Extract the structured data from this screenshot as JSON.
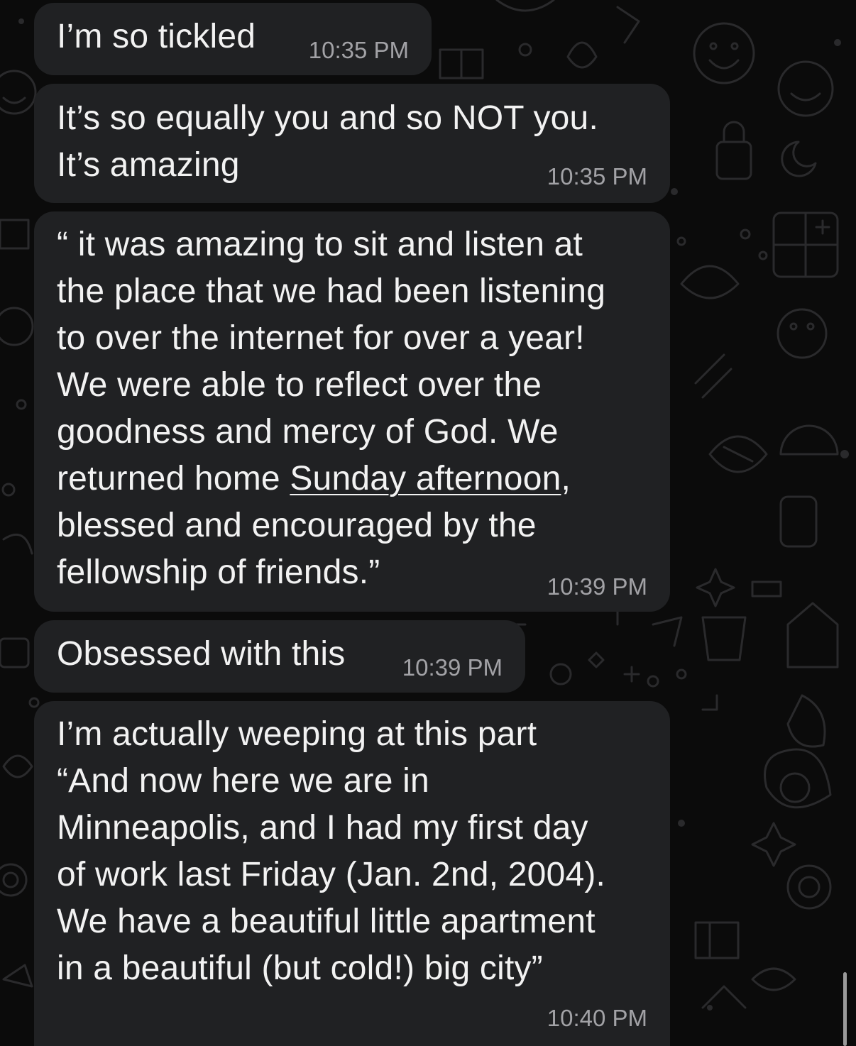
{
  "colors": {
    "background": "#0b0b0b",
    "bubble": "#202123",
    "text": "#f2f2f2",
    "timestamp": "#a2a2a6",
    "wallpaper_doodle": "#2a2a2c"
  },
  "messages": [
    {
      "text": "I’m so tickled",
      "time": "10:35 PM"
    },
    {
      "text": "It’s so equally you and so NOT you.\nIt’s amazing",
      "time": "10:35 PM"
    },
    {
      "text_before": "“ it was amazing to sit and listen at\nthe place that we had been listening\nto over the internet for over a year!\nWe were able to reflect over the\ngoodness and mercy of God.  We\nreturned home ",
      "link": "Sunday afternoon",
      "text_after": ",\nblessed and encouraged by the\nfellowship of friends.”",
      "time": "10:39 PM"
    },
    {
      "text": "Obsessed with this",
      "time": "10:39 PM"
    },
    {
      "text": "I’m actually weeping at this part\n“And now here we are in\nMinneapolis, and I had my first day\nof work last Friday (Jan. 2nd, 2004).\nWe have a beautiful little apartment\nin a beautiful (but cold!) big city”",
      "time": "10:40 PM"
    }
  ]
}
